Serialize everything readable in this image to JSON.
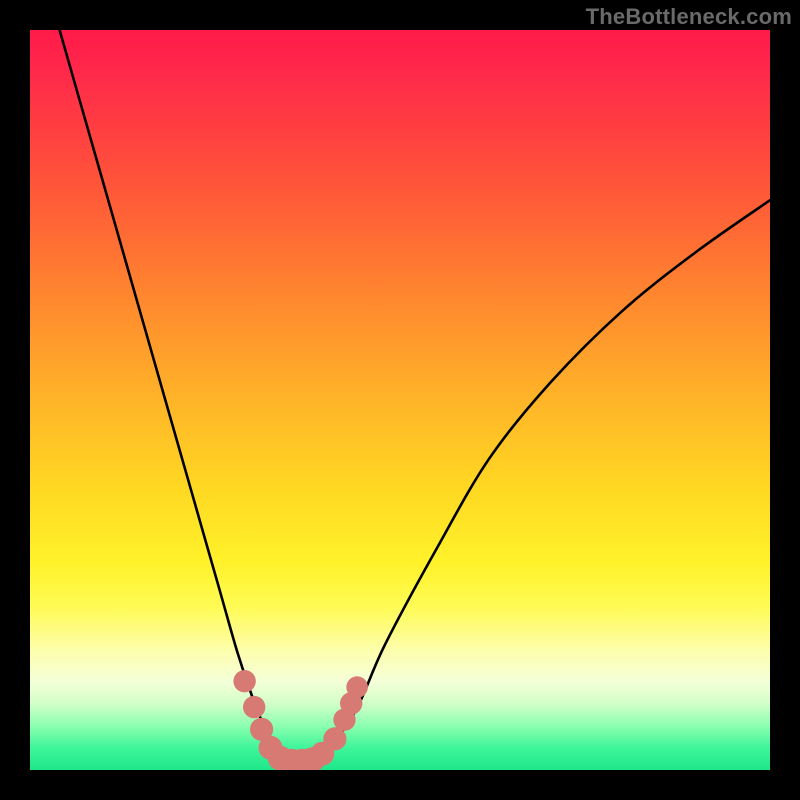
{
  "watermark": {
    "text": "TheBottleneck.com"
  },
  "colors": {
    "frame": "#000000",
    "curve_stroke": "#000000",
    "marker_fill": "#d87a74",
    "marker_stroke": "#c96862",
    "gradient_stops": [
      {
        "pos": 0.0,
        "hex": "#ff1a4a"
      },
      {
        "pos": 0.14,
        "hex": "#ff4040"
      },
      {
        "pos": 0.37,
        "hex": "#ff8a2e"
      },
      {
        "pos": 0.62,
        "hex": "#ffd822"
      },
      {
        "pos": 0.84,
        "hex": "#fdfeae"
      },
      {
        "pos": 0.94,
        "hex": "#8cffb0"
      },
      {
        "pos": 1.0,
        "hex": "#1de789"
      }
    ]
  },
  "chart_data": {
    "type": "line",
    "title": "",
    "xlabel": "",
    "ylabel": "",
    "xlim": [
      0,
      100
    ],
    "ylim": [
      0,
      100
    ],
    "note": "Values are fractions of plot area; x=0..100 left→right, y=0..100 bottom→top. Curve is a V-shaped bottleneck profile.",
    "series": [
      {
        "name": "bottleneck-curve",
        "x": [
          4,
          8,
          12,
          16,
          20,
          24,
          26,
          28,
          30,
          32,
          33.5,
          35.5,
          38,
          40,
          44,
          48,
          55,
          62,
          70,
          80,
          90,
          100
        ],
        "y": [
          100,
          86,
          72,
          58,
          44,
          30,
          23,
          16,
          10,
          5,
          2,
          1.2,
          1.2,
          2.5,
          8,
          17,
          30,
          42,
          52,
          62,
          70,
          77
        ]
      }
    ],
    "markers": [
      {
        "x": 29.0,
        "y": 12.0,
        "r": 1.3
      },
      {
        "x": 30.3,
        "y": 8.5,
        "r": 1.3
      },
      {
        "x": 31.3,
        "y": 5.5,
        "r": 1.4
      },
      {
        "x": 32.5,
        "y": 3.0,
        "r": 1.5
      },
      {
        "x": 33.8,
        "y": 1.6,
        "r": 1.6
      },
      {
        "x": 35.3,
        "y": 1.2,
        "r": 1.6
      },
      {
        "x": 36.8,
        "y": 1.2,
        "r": 1.6
      },
      {
        "x": 38.2,
        "y": 1.4,
        "r": 1.6
      },
      {
        "x": 39.5,
        "y": 2.2,
        "r": 1.5
      },
      {
        "x": 41.2,
        "y": 4.2,
        "r": 1.4
      },
      {
        "x": 42.5,
        "y": 6.8,
        "r": 1.3
      },
      {
        "x": 43.4,
        "y": 9.0,
        "r": 1.3
      },
      {
        "x": 44.2,
        "y": 11.2,
        "r": 1.2
      }
    ]
  }
}
